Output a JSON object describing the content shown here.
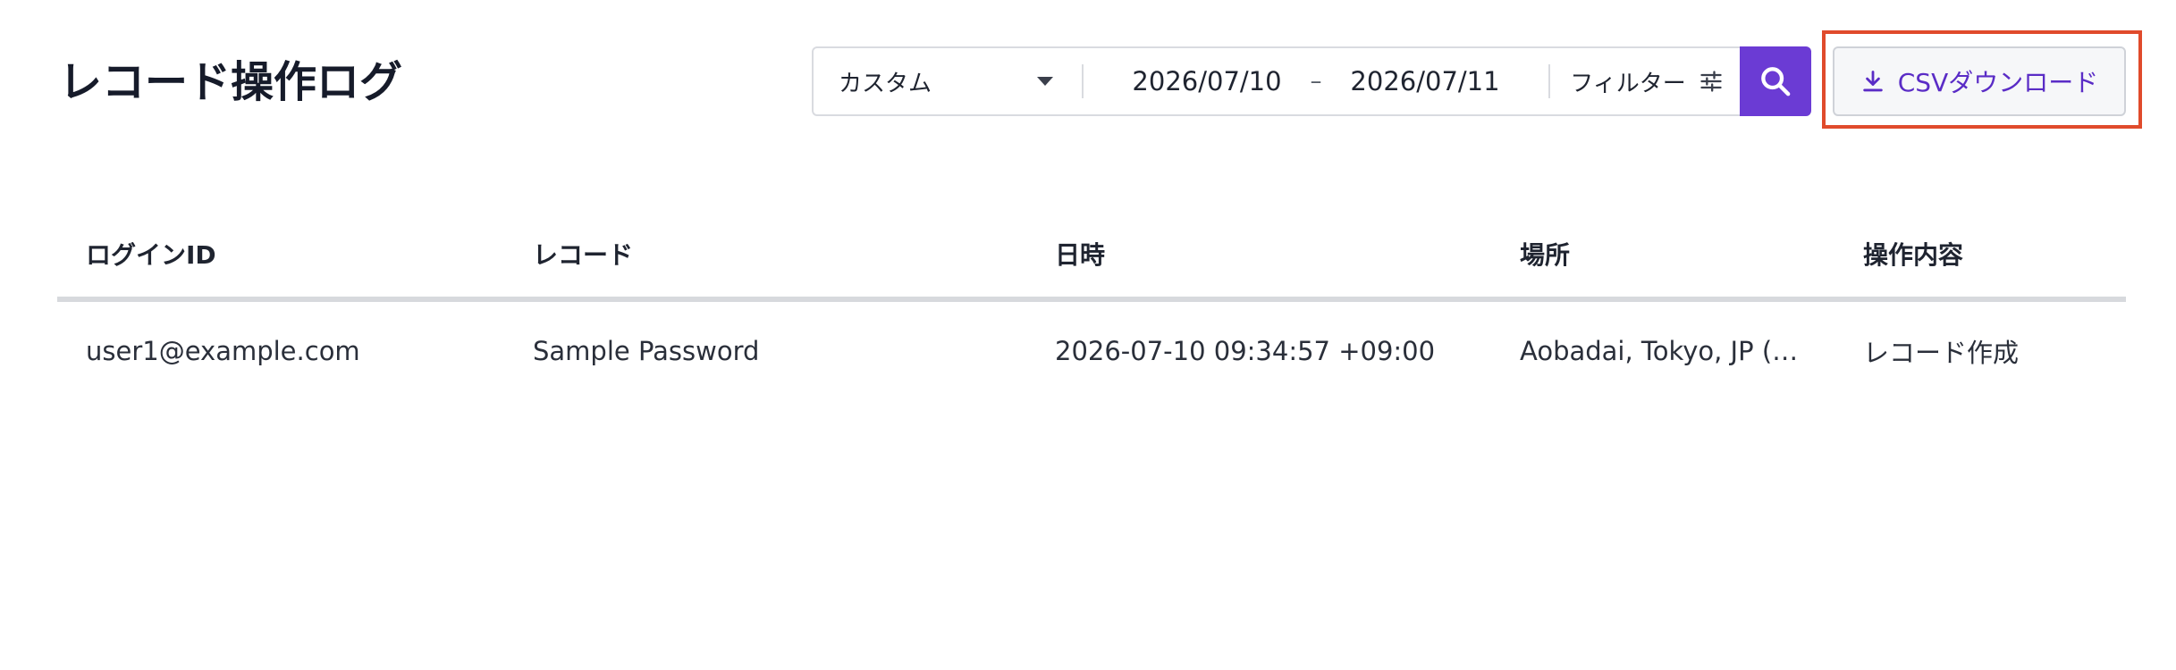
{
  "page": {
    "title": "レコード操作ログ"
  },
  "toolbar": {
    "range_select": {
      "selected": "カスタム",
      "icon": "chevron-down-icon"
    },
    "date_from": "2026/07/10",
    "date_separator": "–",
    "date_to": "2026/07/11",
    "filter_label": "フィルター",
    "filter_icon": "sliders-icon",
    "search_icon": "search-icon",
    "csv_label": "CSVダウンロード",
    "csv_icon": "download-icon"
  },
  "table": {
    "headers": [
      "ログインID",
      "レコード",
      "日時",
      "場所",
      "操作内容"
    ],
    "rows": [
      [
        "user1@example.com",
        "Sample Password",
        "2026-07-10 09:34:57 +09:00",
        "Aobadai, Tokyo, JP (…",
        "レコード作成"
      ]
    ]
  },
  "colors": {
    "accent": "#6b3bd4",
    "csv_text": "#5a2cc6",
    "highlight": "#e04b2c"
  }
}
